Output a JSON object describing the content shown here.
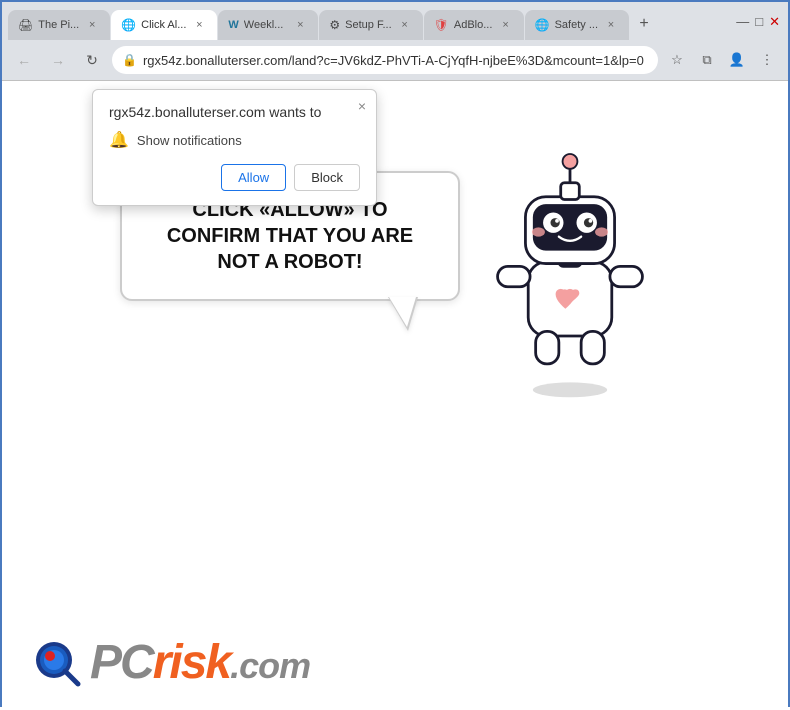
{
  "browser": {
    "tabs": [
      {
        "id": 1,
        "label": "The Pi...",
        "icon_color": "#6b4ea8",
        "active": false,
        "icon": "🖨"
      },
      {
        "id": 2,
        "label": "Click Al...",
        "icon_color": "#4285f4",
        "active": true,
        "icon": "🌐"
      },
      {
        "id": 3,
        "label": "Weekl...",
        "icon_color": "#21759b",
        "active": false,
        "icon": "W"
      },
      {
        "id": 4,
        "label": "Setup F...",
        "icon_color": "#4285f4",
        "active": false,
        "icon": "⚙"
      },
      {
        "id": 5,
        "label": "AdBlo...",
        "icon_color": "#e04040",
        "active": false,
        "icon": "🛡"
      },
      {
        "id": 6,
        "label": "Safety ...",
        "icon_color": "#4285f4",
        "active": false,
        "icon": "🌐"
      }
    ],
    "new_tab_label": "+",
    "address_bar": {
      "url": "rgx54z.bonalluterser.com/land?c=JV6kdZ-PhVTi-A-CjYqfH-njbeE%3D&mcount=1&lp=0",
      "lock_icon": "🔒"
    },
    "nav": {
      "back_label": "←",
      "forward_label": "→",
      "refresh_label": "↻"
    }
  },
  "notification_popup": {
    "title": "rgx54z.bonalluterser.com wants to",
    "close_label": "×",
    "notification_row_text": "Show notifications",
    "allow_button": "Allow",
    "block_button": "Block"
  },
  "page": {
    "speech_bubble_text": "CLICK «ALLOW» TO CONFIRM THAT YOU ARE NOT A ROBOT!",
    "footer_logo": {
      "pc_text": "PC",
      "risk_text": "risk",
      "dotcom_text": ".com"
    }
  },
  "colors": {
    "allow_button_text": "#1a73e8",
    "block_button_border": "#ccc",
    "speech_bubble_border": "#ccc",
    "robot_body": "#fff",
    "robot_outline": "#1a1a2e",
    "robot_visor": "#1a1a2e",
    "robot_cheeks": "#f4a0a0",
    "robot_heart": "#f4a0a0",
    "robot_antenna": "#f4a0a0"
  }
}
